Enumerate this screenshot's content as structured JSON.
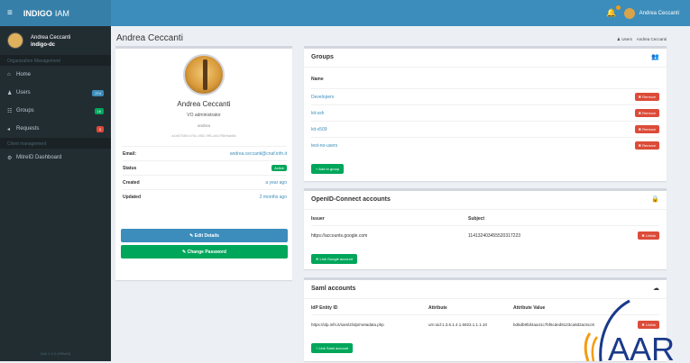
{
  "topbar": {
    "brand_bold": "INDIGO",
    "brand_light": "IAM",
    "hamburger": "≡",
    "user_name": "Andrea Ceccanti",
    "bell": "🔔"
  },
  "sidebar": {
    "user_name": "Andrea Ceccanti",
    "org": "indigo-dc",
    "header1": "Organization Management",
    "items": [
      {
        "icon": "⌂",
        "label": "Home",
        "badge": "",
        "badge_color": ""
      },
      {
        "icon": "♟",
        "label": "Users",
        "badge": "274",
        "badge_color": "#3c8dbc"
      },
      {
        "icon": "☷",
        "label": "Groups",
        "badge": "16",
        "badge_color": "#00a65a"
      },
      {
        "icon": "◂",
        "label": "Requests",
        "badge": "3",
        "badge_color": "#dd4b39"
      }
    ],
    "header2": "Client management",
    "items2": [
      {
        "icon": "⚙",
        "label": "MitreID Dashboard"
      }
    ],
    "footer": "IAM 1.0.0 (f9f0a9f)"
  },
  "page": {
    "title": "Andrea Ceccanti",
    "crumb_icon": "♟",
    "crumb_users": "Users",
    "crumb_current": "Andrea Ceccanti"
  },
  "profile": {
    "name": "Andrea Ceccanti",
    "role": "VO administrator",
    "username": "andrea",
    "uuid": "a1b67589-b75c-4f52-9ff1-a0c7f5b9ab8b",
    "rows": [
      {
        "key": "Email:",
        "value": "andrea.ceccanti@cnaf.infn.it"
      },
      {
        "key": "Status",
        "value": "Active"
      },
      {
        "key": "Created",
        "value": "a year ago"
      },
      {
        "key": "Updated",
        "value": "2 months ago"
      }
    ],
    "edit_label": "✎ Edit Details",
    "password_label": "✎ Change Password"
  },
  "groups": {
    "title": "Groups",
    "icon": "👥",
    "col_name": "Name",
    "items": [
      "Developers",
      "kit-ssh",
      "kit-x509",
      "test-no-users"
    ],
    "remove_label": "✖ Remove",
    "add_label": "+ Add to group"
  },
  "oidc": {
    "title": "OpenID-Connect accounts",
    "icon": "🔒",
    "col_issuer": "Issuer",
    "col_subject": "Subject",
    "issuer": "https://accounts.google.com",
    "subject": "114132403455520317223",
    "unlink_label": "✖ Unlink",
    "link_label": "⊕ Link Google account"
  },
  "saml": {
    "title": "Saml accounts",
    "icon": "☁",
    "col_entity": "IdP Entity ID",
    "col_attr": "Attribute",
    "col_value": "Attribute Value",
    "entity": "https://idp.infn.it/saml2/idp/metadata.php",
    "attr": "urn:oid:1.3.6.1.4.1.5923.1.1.1.10",
    "value": "bd6db9faf4aa41c7bf6cded9123ca8d2ac5cc8",
    "unlink_label": "✖ Unlink",
    "link_label": "+ Link Saml account"
  },
  "logo": {
    "text": "AAR"
  }
}
